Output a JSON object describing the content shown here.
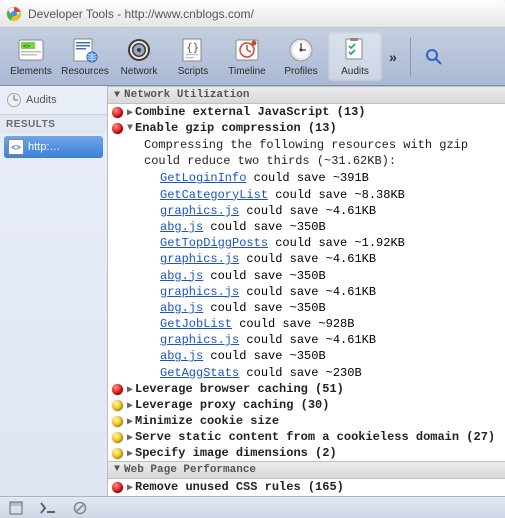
{
  "window": {
    "title": "Developer Tools - http://www.cnblogs.com/"
  },
  "toolbar": {
    "items": [
      {
        "label": "Elements"
      },
      {
        "label": "Resources"
      },
      {
        "label": "Network"
      },
      {
        "label": "Scripts"
      },
      {
        "label": "Timeline"
      },
      {
        "label": "Profiles"
      },
      {
        "label": "Audits"
      }
    ],
    "overflow": "»"
  },
  "sidebar": {
    "header": "Audits",
    "section_title": "RESULTS",
    "items": [
      {
        "label": "http:…"
      }
    ]
  },
  "sections": {
    "net_util": "Network Utilization",
    "web_perf": "Web Page Performance"
  },
  "audits": {
    "combine_js": "Combine external JavaScript (13)",
    "gzip": "Enable gzip compression (13)",
    "gzip_detail": "Compressing the following resources with gzip could reduce two thirds (~31.62KB):",
    "gzip_items": [
      {
        "link": "GetLoginInfo",
        "tail": " could save ~391B"
      },
      {
        "link": "GetCategoryList",
        "tail": " could save ~8.38KB"
      },
      {
        "link": "graphics.js",
        "tail": " could save ~4.61KB"
      },
      {
        "link": "abg.js",
        "tail": " could save ~350B"
      },
      {
        "link": "GetTopDiggPosts",
        "tail": " could save ~1.92KB"
      },
      {
        "link": "graphics.js",
        "tail": " could save ~4.61KB"
      },
      {
        "link": "abg.js",
        "tail": " could save ~350B"
      },
      {
        "link": "graphics.js",
        "tail": " could save ~4.61KB"
      },
      {
        "link": "abg.js",
        "tail": " could save ~350B"
      },
      {
        "link": "GetJobList",
        "tail": " could save ~928B"
      },
      {
        "link": "graphics.js",
        "tail": " could save ~4.61KB"
      },
      {
        "link": "abg.js",
        "tail": " could save ~350B"
      },
      {
        "link": "GetAggStats",
        "tail": " could save ~230B"
      }
    ],
    "browser_cache": "Leverage browser caching (51)",
    "proxy_cache": "Leverage proxy caching (30)",
    "cookie_size": "Minimize cookie size",
    "cookieless": "Serve static content from a cookieless domain (27)",
    "img_dim": "Specify image dimensions (2)",
    "unused_css": "Remove unused CSS rules (165)"
  }
}
